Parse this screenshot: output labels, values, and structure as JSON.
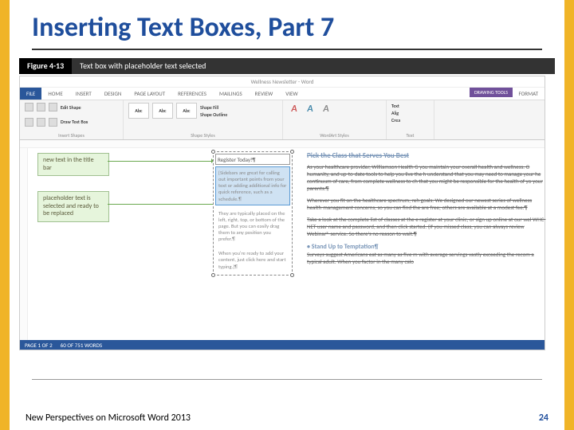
{
  "slide": {
    "title": "Inserting Text Boxes, Part 7",
    "footer_text": "New Perspectives on Microsoft Word 2013",
    "page_number": "24"
  },
  "figure": {
    "label": "Figure 4-13",
    "caption": "Text box with placeholder text selected"
  },
  "callouts": {
    "c1": "new text in the title bar",
    "c2": "placeholder text is selected and ready to be replaced"
  },
  "window": {
    "title": "Wellness Newsletter - Word"
  },
  "tabs": {
    "file": "FILE",
    "home": "HOME",
    "insert": "INSERT",
    "design": "DESIGN",
    "layout": "PAGE LAYOUT",
    "references": "REFERENCES",
    "mailings": "MAILINGS",
    "review": "REVIEW",
    "view": "VIEW",
    "drawing_tools": "DRAWING TOOLS",
    "format": "FORMAT"
  },
  "ribbon": {
    "edit_shape": "Edit Shape",
    "draw_text_box": "Draw Text Box",
    "insert_shapes": "Insert Shapes",
    "shape_styles": "Shape Styles",
    "wordart_styles": "WordArt Styles",
    "shape_fill": "Shape Fill",
    "shape_outline": "Shape Outline",
    "abc": "Abc",
    "text_label": "Text",
    "text_dir": "Text",
    "align": "Alig",
    "create": "Crea"
  },
  "textbox": {
    "title_text": "Register Today!¶",
    "placeholder1": "[Sidebars are great for calling out important points from your text or adding additional info for quick reference, such as a schedule.¶",
    "placeholder2": "They are typically placed on the left, right, top, or bottom of the page. But you can easily drag them to any position you prefer.¶",
    "placeholder3": "When you're ready to add your content, just click here and start typing.]¶"
  },
  "document": {
    "heading": "Pick the Class that Serves You Best",
    "p1": "As your healthcare provider, Williamson Health G you maintain your overall health and wellness. O humanity, and up-to-date tools to help you live the h understand that you may need to manage your he continuum of care, from complete wellness to ch that you might be responsible for the health of yo your parents.¶",
    "p2": "Wherever you fit on the healthcare spectrum, reh goals. We designed our newest series of wellness health-management concerns, so you can find the are free; others are available at a modest fee.¶",
    "p3": "Take a look at the complete list of classes at the e register at your clinic, or sign up online at our wel WHC-NET user name and password, and then click started. (If you missed class, you can always review Webinar® service. So there's no reason to wait.¶",
    "subhead": "• Stand Up to Temptation¶",
    "p4": "Surveys suggest Americans eat as many as five m with average servings vastly exceeding the recom a typical adult. When you factor in the many calo"
  },
  "statusbar": {
    "page": "PAGE 1 OF 2",
    "words": "60 OF 751 WORDS"
  }
}
